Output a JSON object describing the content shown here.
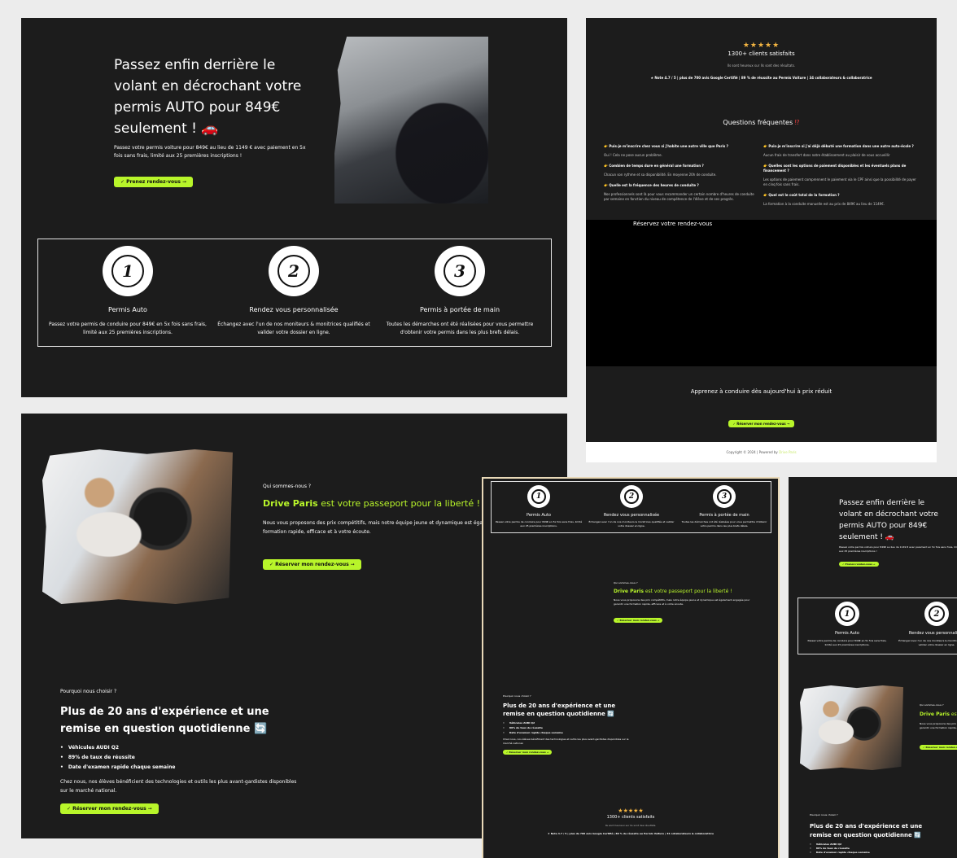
{
  "hero": {
    "title": "Passez enfin derrière le volant en décrochant votre permis AUTO pour 849€ seulement ! 🚗",
    "text": "Passez votre permis voiture pour 849€ au lieu de 1149 € avec paiement en 5x fois sans frais, limité aux 25 premières inscriptions !",
    "cta": "✓ Prenez rendez-vous ➞"
  },
  "features": [
    {
      "num": "1",
      "title": "Permis Auto",
      "text": "Passez votre permis de conduire pour 849€ en 5x fois sans frais, limité aux 25 premières inscriptions."
    },
    {
      "num": "2",
      "title": "Rendez vous personnalisée",
      "text": "Échangez avec l'un de nos moniteurs & monitrices qualifiés et valider votre dossier en ligne."
    },
    {
      "num": "3",
      "title": "Permis à portée de main",
      "text": "Toutes les démarches ont été réalisées pour vous permettre d'obtenir votre permis dans les plus brefs délais."
    }
  ],
  "reviews": {
    "stars": "★★★★★",
    "title": "1300+ clients satisfaits",
    "sub": "Ils sont heureux sur Ils sont des résultats.",
    "line": "★ Note 4.7 / 5 | plus de 700 avis Google Certifié | 89 % de réussite au Permis Voiture | 34 collaborateurs & collaboratrice"
  },
  "faq": {
    "title": "Questions fréquentes",
    "title_mark": "⁉",
    "left": [
      {
        "q": "👉 Puis-je m'inscrire chez vous si j'habite une autre ville que Paris ?",
        "a": "Oui ! Cela ne pose aucun problème."
      },
      {
        "q": "👉 Combien de temps dure en général une formation ?",
        "a": "Chacun son rythme et sa disponibilité. En moyenne 20h de conduite."
      },
      {
        "q": "👉 Quelle est la fréquence des heures de conduite ?",
        "a": "Nos professionnels sont là pour vous recommander un certain nombre d'heures de conduite par semaine en fonction du niveau de compétence de l'élève et de ses progrès."
      }
    ],
    "right": [
      {
        "q": "👉 Puis-je m'inscrire si j'ai déjà débuté une formation dans une autre auto-école ?",
        "a": "Aucun frais de transfert dans notre établissement au plaisir de vous accueillir"
      },
      {
        "q": "👉 Quelles sont les options de paiement disponibles et les éventuels plans de financement ?",
        "a": "Les options de paiement comprennent le paiement via le CPF ainsi que la possibilité de payer en cinq fois sans frais."
      },
      {
        "q": "👉 Quel est le coût total de la formation ?",
        "a": "La formation à la conduite manuelle est au prix de 849€ au lieu de 1149€."
      }
    ]
  },
  "booking": {
    "title": "Réservez votre rendez-vous"
  },
  "learn": {
    "title": "Apprenez à conduire dès aujourd'hui à prix réduit",
    "cta": "✓ Réserver mon rendez-vous ➞"
  },
  "footer": {
    "text": "Copyright © 2024 | Powered by",
    "brand": "Drive Paris"
  },
  "about": {
    "kicker": "Qui sommes-nous ?",
    "brand": "Drive Paris",
    "headline_rest": " est votre passeport pour la liberté !",
    "text": "Nous vous proposons des prix compétitifs, mais notre équipe jeune et dynamique est également engagée pour garantir une formation rapide, efficace et à votre écoute.",
    "cta": "✓ Réserver mon rendez-vous ➞"
  },
  "why": {
    "kicker": "Pourquoi nous choisir ?",
    "title": "Plus de 20 ans d'expérience et une remise en question quotidienne 🔄",
    "bullets": [
      "Véhicules AUDI Q2",
      "89% de taux de réussite",
      "Date d'examen rapide chaque semaine"
    ],
    "text": "Chez nous, nos élèves bénéficient des technologies et outils les plus avant-gardistes disponibles sur le marché national.",
    "cta": "✓ Réserver mon rendez-vous ➞"
  },
  "colors": {
    "accent": "#b8f52a",
    "panel": "#1c1c1c",
    "stars": "#f5b642"
  }
}
